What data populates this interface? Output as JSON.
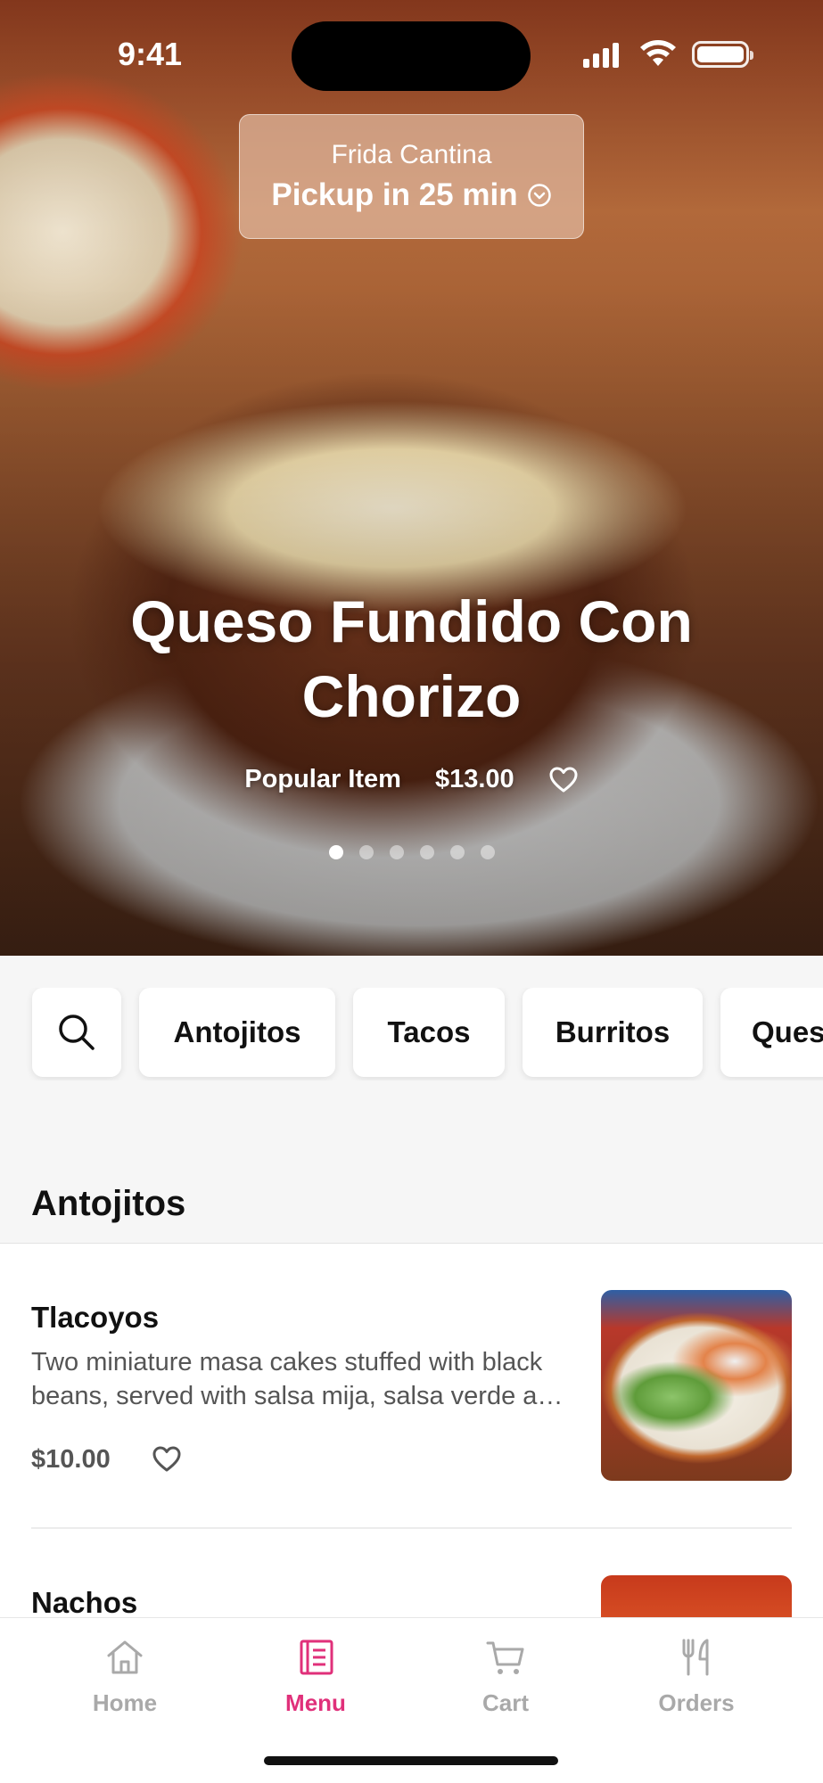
{
  "status": {
    "time": "9:41"
  },
  "header": {
    "restaurant": "Frida Cantina",
    "pickup": "Pickup in 25 min"
  },
  "hero": {
    "title": "Queso Fundido Con Chorizo",
    "tag": "Popular Item",
    "price": "$13.00",
    "slides": 6,
    "active_slide": 1
  },
  "categories": [
    "Antojitos",
    "Tacos",
    "Burritos",
    "Ques"
  ],
  "section": {
    "title": "Antojitos"
  },
  "items": [
    {
      "name": "Tlacoyos",
      "description": "Two miniature masa cakes stuffed with black beans, served with salsa mija, salsa verde and crema",
      "price": "$10.00"
    },
    {
      "name": "Nachos",
      "description": "",
      "price": ""
    }
  ],
  "tabs": [
    {
      "label": "Home",
      "icon": "home-icon",
      "active": false
    },
    {
      "label": "Menu",
      "icon": "menu-icon",
      "active": true
    },
    {
      "label": "Cart",
      "icon": "cart-icon",
      "active": false
    },
    {
      "label": "Orders",
      "icon": "utensils-icon",
      "active": false
    }
  ],
  "colors": {
    "accent": "#e0307a",
    "inactive": "#a9a9a9"
  }
}
